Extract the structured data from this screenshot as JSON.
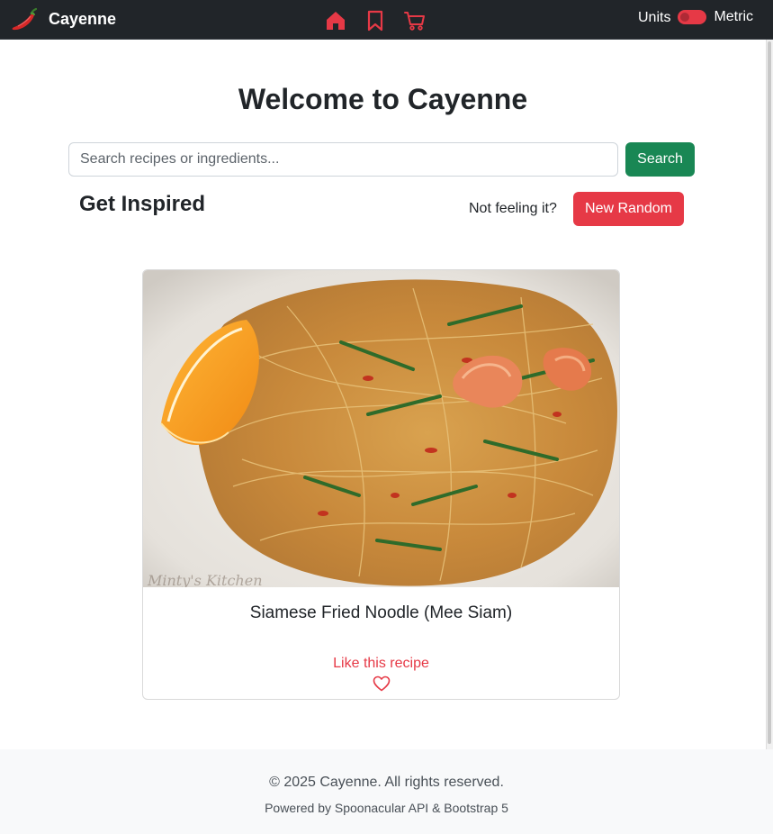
{
  "navbar": {
    "brand": "Cayenne",
    "units_label": "Units",
    "units_value": "Metric",
    "icons": [
      "home-icon",
      "bookmark-icon",
      "cart-icon"
    ],
    "accent_color": "#e63946"
  },
  "main": {
    "title": "Welcome to Cayenne",
    "search": {
      "placeholder": "Search recipes or ingredients...",
      "value": "",
      "button_label": "Search"
    },
    "inspired": {
      "title": "Get Inspired",
      "prompt": "Not feeling it?",
      "button_label": "New Random"
    },
    "card": {
      "title": "Siamese Fried Noodle (Mee Siam)",
      "like_label": "Like this recipe",
      "image_watermark": "Minty's Kitchen"
    }
  },
  "footer": {
    "copyright": "© 2025 Cayenne. All rights reserved.",
    "powered_by": "Powered by Spoonacular API & Bootstrap 5"
  },
  "colors": {
    "navbar_bg": "#212529",
    "primary_red": "#e63946",
    "success_green": "#198754",
    "footer_bg": "#f8f9fa"
  }
}
